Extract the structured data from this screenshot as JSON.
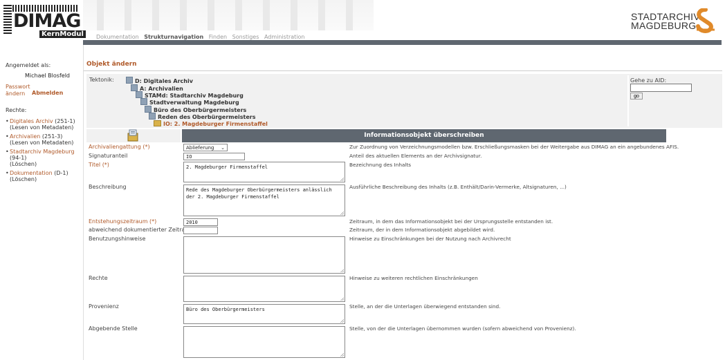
{
  "header": {
    "logo_word": "DIMAG",
    "logo_sub": "KernModul",
    "nav": [
      "Dokumentation",
      "Strukturnavigation",
      "Finden",
      "Sonstiges",
      "Administration"
    ],
    "org_line1": "STADTARCHIV",
    "org_line2": "MAGDEBURG"
  },
  "sidebar": {
    "logged_in_label": "Angemeldet als:",
    "user_name": "Michael Blosfeld",
    "change_password": "Passwort ändern",
    "logout": "Abmelden",
    "rights_label": "Rechte:",
    "rights": [
      {
        "name": "Digitales Archiv",
        "code": "(251-1)",
        "perm": "(Lesen von Metadaten)"
      },
      {
        "name": "Archivalien",
        "code": "(251-3)",
        "perm": "(Lesen von Metadaten)"
      },
      {
        "name": "Stadtarchiv Magdeburg",
        "code": "(94-1)",
        "perm": "(Löschen)"
      },
      {
        "name": "Dokumentation",
        "code": "(D-1)",
        "perm": "(Löschen)"
      }
    ]
  },
  "page": {
    "title": "Objekt ändern",
    "tektonik_label": "Tektonik:",
    "tree": [
      "D: Digitales Archiv",
      "A: Archivalien",
      "STAMd: Stadtarchiv Magdeburg",
      "Stadtverwaltung Magdeburg",
      "Büro des Oberbürgermeisters",
      "Reden des Oberbürgermeisters",
      "IO: 2. Magdeburger Firmenstaffel"
    ],
    "goto_label": "Gehe zu AID:",
    "goto_value": "",
    "goto_button": "go"
  },
  "form": {
    "header_title": "Informationsobjekt überschreiben",
    "fields": [
      {
        "label": "Archivaliengattung (*)",
        "value": "Ablieferung",
        "hint": "Zur Zuordnung von Verzeichnungsmodellen bzw. Erschließungsmasken bei der Weitergabe aus DIMAG an ein angebundenes AFIS."
      },
      {
        "label": "Signaturanteil",
        "value": "IO",
        "hint": "Anteil des aktuellen Elements an der Archivsignatur."
      },
      {
        "label": "Titel (*)",
        "value": "2. Magdeburger Firmenstaffel",
        "hint": "Bezeichnung des Inhalts"
      },
      {
        "label": "Beschreibung",
        "value": "Rede des Magdeburger Oberbürgermeisters anlässlich der 2. Magdeburger Firmenstaffel",
        "hint": "Ausführliche Beschreibung des Inhalts (z.B. Enthält/Darin-Vermerke, Altsignaturen, ...)"
      },
      {
        "label": "Entstehungszeitraum (*)",
        "value": "2010",
        "hint": "Zeitraum, in dem das Informationsobjekt bei der Ursprungsstelle entstanden ist."
      },
      {
        "label": "abweichend dokumentierter Zeitraum",
        "value": "",
        "hint": "Zeitraum, der in dem Informationsobjekt abgebildet wird."
      },
      {
        "label": "Benutzungshinweise",
        "value": "",
        "hint": "Hinweise zu Einschränkungen bei der Nutzung nach Archivrecht"
      },
      {
        "label": "Rechte",
        "value": "",
        "hint": "Hinweise zu weiteren rechtlichen Einschränkungen"
      },
      {
        "label": "Provenienz",
        "value": "Büro des Oberbürgermeisters",
        "hint": "Stelle, an der die Unterlagen überwiegend entstanden sind."
      },
      {
        "label": "Abgebende Stelle",
        "value": "",
        "hint": "Stelle, von der die Unterlagen übernommen wurden (sofern abweichend von Provenienz)."
      }
    ]
  },
  "colors": {
    "accent": "#b05a2a",
    "bar": "#5f6770",
    "panel": "#f1f1f1"
  }
}
